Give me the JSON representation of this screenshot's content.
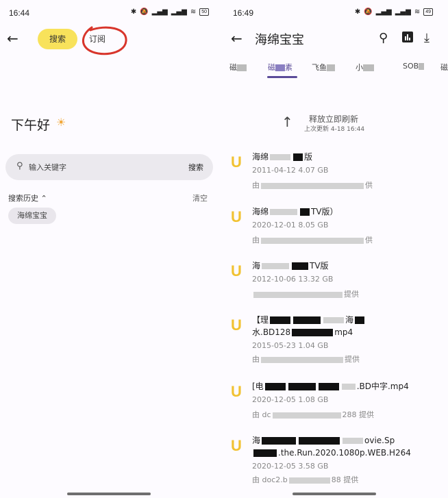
{
  "left": {
    "status_time": "16:44",
    "battery": "50",
    "tab_search": "搜索",
    "tab_subscribe": "订阅",
    "greeting": "下午好",
    "search_placeholder": "输入关键字",
    "search_button": "搜索",
    "history_title": "搜索历史 ⌃",
    "history_clear": "清空",
    "history_items": [
      "海绵宝宝"
    ],
    "icons": [
      "back-arrow-icon",
      "sun-icon",
      "search-icon"
    ]
  },
  "right": {
    "status_time": "16:49",
    "battery": "49",
    "title": "海绵宝宝",
    "tabs": [
      {
        "label": "磁"
      },
      {
        "label": "磁"
      },
      {
        "label": "素"
      },
      {
        "label": "飞鱼"
      },
      {
        "label": "小"
      },
      {
        "label": "SOB"
      },
      {
        "label": "磁"
      }
    ],
    "refresh_text": "释放立即刷新",
    "refresh_time": "上次更新 4-18 16:44",
    "results": [
      {
        "title": [
          "海绵",
          "版"
        ],
        "meta": "2011-04-12 4.07 GB",
        "provider": "由",
        "provider_end": "供"
      },
      {
        "title": [
          "海绵",
          "TV版）"
        ],
        "meta": "2020-12-01 8.05 GB",
        "provider": "由",
        "provider_end": "供"
      },
      {
        "title": [
          "海",
          "TV版"
        ],
        "meta": "2012-10-06 13.32 GB",
        "provider": "",
        "provider_end": "提供"
      },
      {
        "title": [
          "【理",
          "海",
          "水.BD128",
          "mp4"
        ],
        "meta": "2015-05-23 1.04 GB",
        "provider": "由",
        "provider_end": "提供"
      },
      {
        "title": [
          "[电",
          ".BD中字.mp4"
        ],
        "meta": "2020-12-05 1.08 GB",
        "provider": "由 dc",
        "provider_end": "288 提供"
      },
      {
        "title": [
          "海",
          "ovie.Sp",
          ".the.Run.2020.1080p.WEB.H264"
        ],
        "meta": "2020-12-05 3.58 GB",
        "provider": "由 doc2.b",
        "provider_end": "88 提供"
      }
    ],
    "icons": [
      "back-arrow-icon",
      "search-icon",
      "chart-icon",
      "download-icon",
      "refresh-arrow-icon"
    ]
  }
}
